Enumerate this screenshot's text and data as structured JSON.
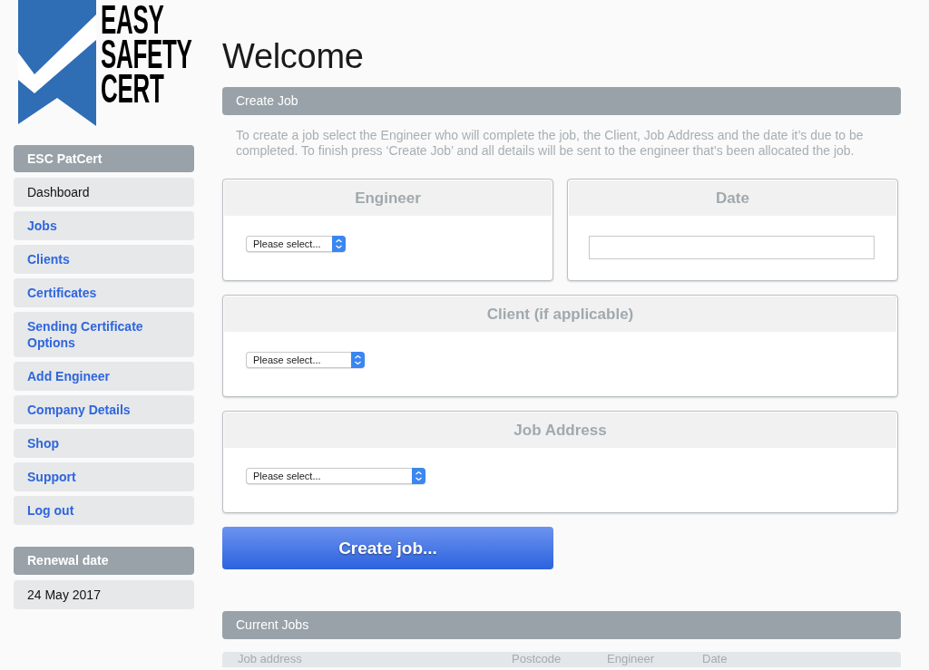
{
  "logo": {
    "lines": [
      "EASY",
      "SAFETY",
      "CERT"
    ]
  },
  "sidebar": {
    "title": "ESC PatCert",
    "items": [
      {
        "label": "Dashboard",
        "selected": true
      },
      {
        "label": "Jobs",
        "selected": false
      },
      {
        "label": "Clients",
        "selected": false
      },
      {
        "label": "Certificates",
        "selected": false
      },
      {
        "label": "Sending Certificate Options",
        "selected": false
      },
      {
        "label": "Add Engineer",
        "selected": false
      },
      {
        "label": "Company Details",
        "selected": false
      },
      {
        "label": "Shop",
        "selected": false
      },
      {
        "label": "Support",
        "selected": false
      },
      {
        "label": "Log out",
        "selected": false
      }
    ],
    "renewal": {
      "title": "Renewal date",
      "date": "24 May 2017"
    }
  },
  "page_title": "Welcome",
  "create_job": {
    "title": "Create Job",
    "description": "To create a job select the Engineer who will complete the job, the Client, Job Address and the date it’s due to be completed. To finish press ‘Create Job’ and all details will be sent to the engineer that’s been allocated the job.",
    "rows": [
      [
        {
          "label": "Engineer",
          "kind": "select",
          "value": "Please select..."
        },
        {
          "label": "Date",
          "kind": "text"
        }
      ],
      [
        {
          "label": "Client (if applicable)",
          "kind": "select",
          "value": "Please select..."
        }
      ],
      [
        {
          "label": "Job Address",
          "kind": "select",
          "value": "Please select..."
        }
      ]
    ],
    "button": "Create job..."
  },
  "current_jobs": {
    "title": "Current Jobs",
    "columns": [
      "Job address",
      "Postcode",
      "Engineer",
      "Date"
    ]
  }
}
